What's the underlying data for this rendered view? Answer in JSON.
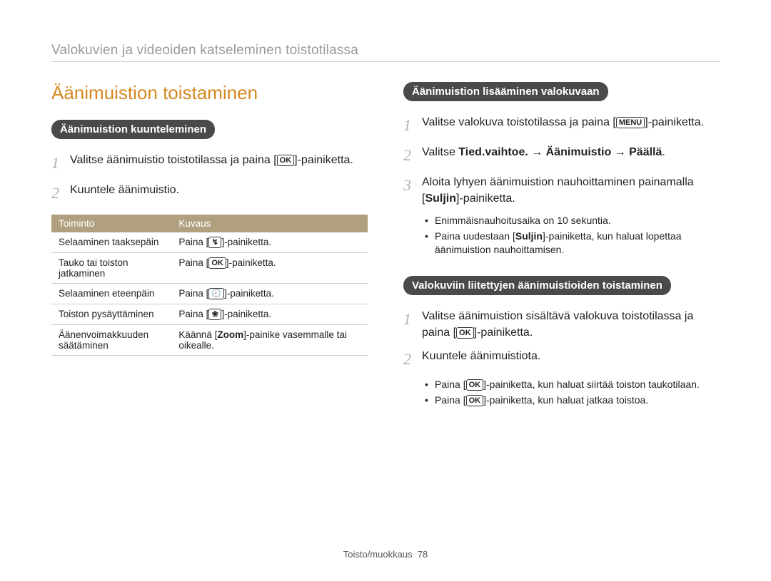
{
  "breadcrumb": "Valokuvien ja videoiden katseleminen toistotilassa",
  "left": {
    "title": "Äänimuistion toistaminen",
    "section1_heading": "Äänimuistion kuunteleminen",
    "step1_a": "Valitse äänimuistio toistotilassa ja paina [",
    "step1_icon": "OK",
    "step1_b": "]-painiketta.",
    "step2": "Kuuntele äänimuistio.",
    "table": {
      "col1": "Toiminto",
      "col2": "Kuvaus",
      "rows": [
        {
          "f": "Selaaminen taaksepäin",
          "d_a": "Paina [",
          "d_icon": "↯",
          "d_b": "]-painiketta."
        },
        {
          "f": "Tauko tai toiston jatkaminen",
          "d_a": "Paina [",
          "d_icon": "OK",
          "d_b": "]-painiketta."
        },
        {
          "f": "Selaaminen eteenpäin",
          "d_a": "Paina [",
          "d_icon": "🕘",
          "d_b": "]-painiketta."
        },
        {
          "f": "Toiston pysäyttäminen",
          "d_a": "Paina [",
          "d_icon": "❀",
          "d_b": "]-painiketta."
        },
        {
          "f": "Äänenvoimakkuuden säätäminen",
          "d_full": "Käännä [Zoom]-painike vasemmalle tai oikealle.",
          "d_bold": "Zoom"
        }
      ]
    }
  },
  "right": {
    "section1_heading": "Äänimuistion lisääminen valokuvaan",
    "s1_step1_a": "Valitse valokuva toistotilassa ja paina [",
    "s1_step1_icon": "MENU",
    "s1_step1_b": "]-painiketta.",
    "s1_step2_a": "Valitse ",
    "s1_step2_bold": "Tied.vaihtoe. → Äänimuistio → Päällä",
    "s1_step2_b": ".",
    "s1_step3_a": "Aloita lyhyen äänimuistion nauhoittaminen painamalla [",
    "s1_step3_bold": "Suljin",
    "s1_step3_b": "]-painiketta.",
    "s1_bullet1": "Enimmäisnauhoitusaika on 10 sekuntia.",
    "s1_bullet2_a": "Paina uudestaan [",
    "s1_bullet2_bold": "Suljin",
    "s1_bullet2_b": "]-painiketta, kun haluat lopettaa äänimuistion nauhoittamisen.",
    "section2_heading": "Valokuviin liitettyjen äänimuistioiden toistaminen",
    "s2_step1_a": "Valitse äänimuistion sisältävä valokuva toistotilassa ja paina [",
    "s2_step1_icon": "OK",
    "s2_step1_b": "]-painiketta.",
    "s2_step2": "Kuuntele äänimuistiota.",
    "s2_bullet1_a": "Paina [",
    "s2_bullet1_icon": "OK",
    "s2_bullet1_b": "]-painiketta, kun haluat siirtää toiston taukotilaan.",
    "s2_bullet2_a": "Paina [",
    "s2_bullet2_icon": "OK",
    "s2_bullet2_b": "]-painiketta, kun haluat jatkaa toistoa."
  },
  "footer_a": "Toisto/muokkaus",
  "footer_b": "78"
}
